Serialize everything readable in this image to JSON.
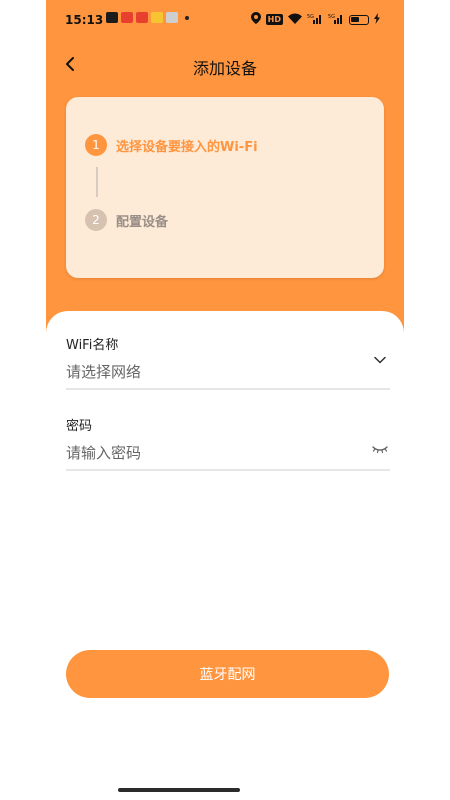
{
  "status_bar": {
    "time": "15:13",
    "hd_label": "HD",
    "signal_label_1": "5G",
    "signal_label_2": "5G",
    "battery_level": "45"
  },
  "nav": {
    "title": "添加设备"
  },
  "steps": [
    {
      "number": "1",
      "label": "选择设备要接入的Wi-Fi",
      "active": true
    },
    {
      "number": "2",
      "label": "配置设备",
      "active": false
    }
  ],
  "form": {
    "wifi": {
      "label": "WiFi名称",
      "placeholder": "请选择网络"
    },
    "password": {
      "label": "密码",
      "placeholder": "请输入密码"
    }
  },
  "actions": {
    "bluetooth_button": "蓝牙配网"
  },
  "colors": {
    "accent": "#ff953f",
    "card_bg": "#fdead7",
    "inactive_step": "#d7c2b2"
  }
}
